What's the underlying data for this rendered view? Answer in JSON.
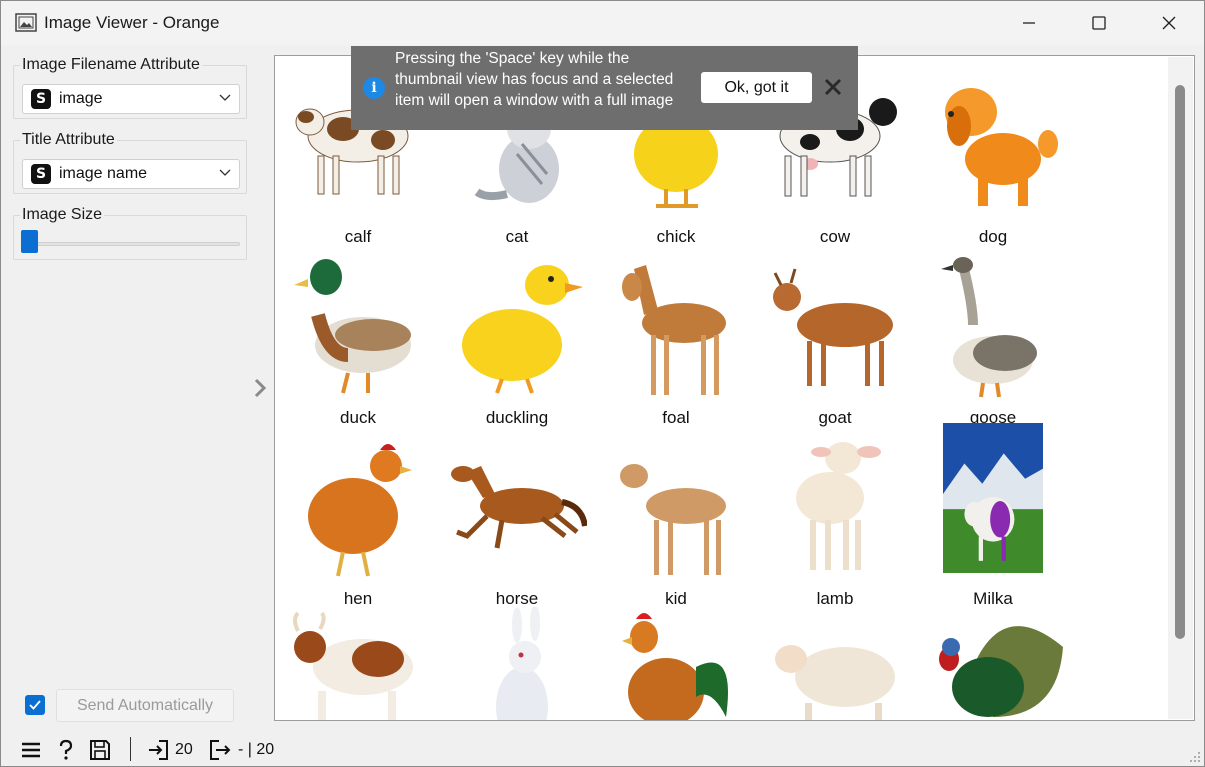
{
  "window": {
    "title": "Image Viewer - Orange"
  },
  "left_panel": {
    "filename_group": {
      "title": "Image Filename Attribute",
      "type_badge": "S",
      "selected": "image"
    },
    "title_group": {
      "title": "Title Attribute",
      "type_badge": "S",
      "selected": "image name"
    },
    "size_group": {
      "title": "Image Size"
    },
    "send_automatically": {
      "label": "Send Automatically",
      "checked": true
    }
  },
  "notification": {
    "text": "Pressing the 'Space' key while the thumbnail view has focus and a selected item will open a window with a full image",
    "ok_label": "Ok, got it"
  },
  "thumbnails": [
    {
      "label": "calf"
    },
    {
      "label": "cat"
    },
    {
      "label": "chick"
    },
    {
      "label": "cow"
    },
    {
      "label": "dog"
    },
    {
      "label": "duck"
    },
    {
      "label": "duckling"
    },
    {
      "label": "foal"
    },
    {
      "label": "goat"
    },
    {
      "label": "goose"
    },
    {
      "label": "hen"
    },
    {
      "label": "horse"
    },
    {
      "label": "kid"
    },
    {
      "label": "lamb"
    },
    {
      "label": "Milka"
    },
    {
      "label": ""
    },
    {
      "label": ""
    },
    {
      "label": ""
    },
    {
      "label": ""
    },
    {
      "label": ""
    }
  ],
  "statusbar": {
    "input_count": "20",
    "output_count": "- | 20"
  },
  "colors": {
    "accent": "#0a6fd0",
    "toast_bg": "#6e6e6e",
    "info_icon": "#1e88e5"
  }
}
